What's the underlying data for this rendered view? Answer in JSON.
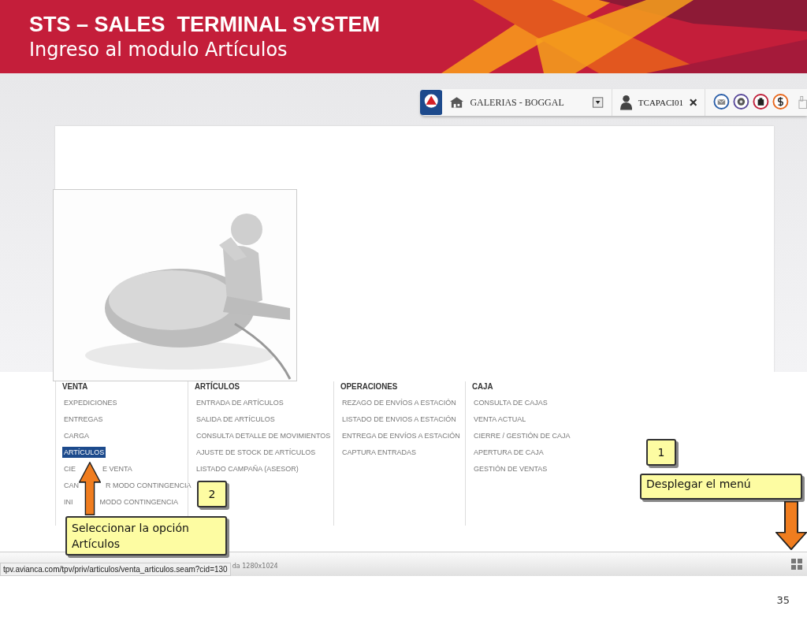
{
  "header": {
    "title": "STS – SALES  TERMINAL SYSTEM",
    "subtitle": "Ingreso al modulo Artículos"
  },
  "top_bar": {
    "office": "GALERIAS - BOGGAL",
    "user": "TCAPACI01"
  },
  "menu": {
    "columns": [
      {
        "heading": "VENTA",
        "items": [
          {
            "segments": [
              "EXPEDICIONES"
            ],
            "selected": false
          },
          {
            "segments": [
              "ENTREGAS"
            ],
            "selected": false
          },
          {
            "segments": [
              "CARGA"
            ],
            "selected": false
          },
          {
            "segments": [
              "ARTÍCULOS"
            ],
            "selected": true
          },
          {
            "segments": [
              "CIE",
              "E VENTA"
            ],
            "selected": false
          },
          {
            "segments": [
              "CAN",
              "R MODO CONTINGENCIA"
            ],
            "selected": false
          },
          {
            "segments": [
              "INI",
              "MODO CONTINGENCIA"
            ],
            "selected": false
          }
        ]
      },
      {
        "heading": "ARTÍCULOS",
        "items": [
          {
            "segments": [
              "ENTRADA DE ARTÍCULOS"
            ],
            "selected": false
          },
          {
            "segments": [
              "SALIDA DE ARTÍCULOS"
            ],
            "selected": false
          },
          {
            "segments": [
              "CONSULTA DETALLE DE MOVIMIENTOS"
            ],
            "selected": false
          },
          {
            "segments": [
              "AJUSTE DE STOCK DE ARTÍCULOS"
            ],
            "selected": false
          },
          {
            "segments": [
              "LISTADO CAMPAÑA (ASESOR)"
            ],
            "selected": false
          }
        ]
      },
      {
        "heading": "OPERACIONES",
        "items": [
          {
            "segments": [
              "REZAGO DE ENVÍOS A ESTACIÓN"
            ],
            "selected": false
          },
          {
            "segments": [
              "LISTADO DE ENVIOS A ESTACIÓN"
            ],
            "selected": false
          },
          {
            "segments": [
              "ENTREGA DE ENVÍOS A ESTACIÓN"
            ],
            "selected": false
          },
          {
            "segments": [
              "CAPTURA ENTRADAS"
            ],
            "selected": false
          }
        ]
      },
      {
        "heading": "CAJA",
        "items": [
          {
            "segments": [
              "CONSULTA DE CAJAS"
            ],
            "selected": false
          },
          {
            "segments": [
              "VENTA ACTUAL"
            ],
            "selected": false
          },
          {
            "segments": [
              "CIERRE / GESTIÓN DE CAJA"
            ],
            "selected": false
          },
          {
            "segments": [
              "APERTURA DE CAJA"
            ],
            "selected": false
          },
          {
            "segments": [
              "GESTIÓN DE VENTAS"
            ],
            "selected": false
          }
        ]
      }
    ]
  },
  "status_bar": {
    "url": "tpv.avianca.com/tpv/priv/articulos/venta_articulos.seam?cid=130",
    "note": "da 1280x1024"
  },
  "callouts": [
    {
      "kind": "one",
      "number": "1",
      "text": "Desplegar el menú"
    },
    {
      "kind": "two",
      "number": "2",
      "text": "Seleccionar la opción Artículos"
    }
  ],
  "page_number": "35"
}
